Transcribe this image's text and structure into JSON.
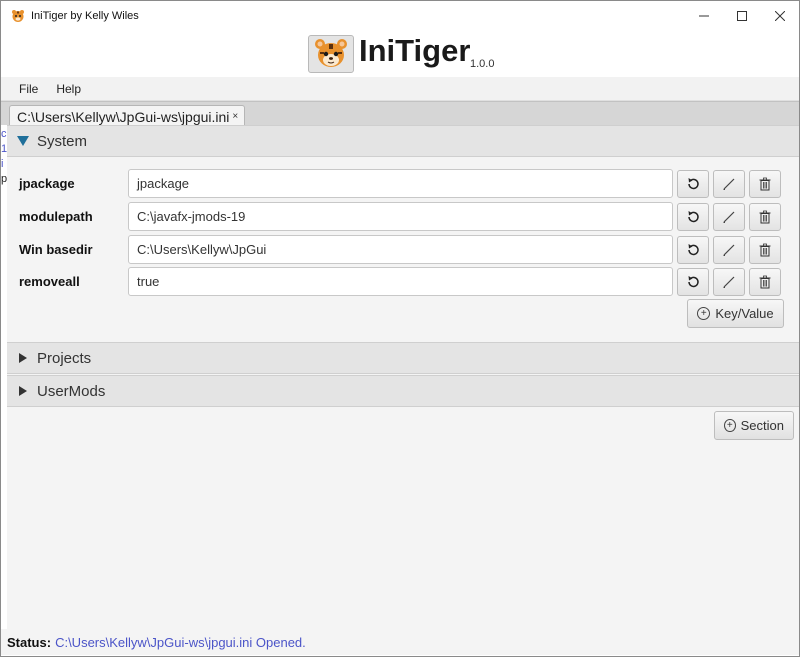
{
  "window": {
    "title": "IniTiger by Kelly Wiles",
    "controls": {
      "minimize": "—",
      "maximize": "☐",
      "close": "✕"
    }
  },
  "header": {
    "app_name": "IniTiger",
    "version": "1.0.0",
    "logo_icon": "tiger-logo-icon"
  },
  "menu": {
    "items": [
      {
        "label": "File"
      },
      {
        "label": "Help"
      }
    ]
  },
  "tabs": [
    {
      "label": "C:\\Users\\Kellyw\\JpGui-ws\\jpgui.ini",
      "close": "×",
      "active": true
    }
  ],
  "sections": [
    {
      "label": "System",
      "expanded": true,
      "entries": [
        {
          "key": "jpackage",
          "value": "jpackage"
        },
        {
          "key": "modulepath",
          "value": "C:\\javafx-jmods-19"
        },
        {
          "key": "Win basedir",
          "value": "C:\\Users\\Kellyw\\JpGui"
        },
        {
          "key": "removeall",
          "value": "true"
        }
      ],
      "add_key_value_label": "Key/Value"
    },
    {
      "label": "Projects",
      "expanded": false
    },
    {
      "label": "UserMods",
      "expanded": false
    }
  ],
  "add_section_label": "Section",
  "status": {
    "label": "Status:",
    "text": "C:\\Users\\Kellyw\\JpGui-ws\\jpgui.ini Opened."
  },
  "colors": {
    "accent_arrow": "#1f6f9a",
    "status_text": "#4b54c8",
    "pane_header_bg": "#e4e4e4"
  }
}
